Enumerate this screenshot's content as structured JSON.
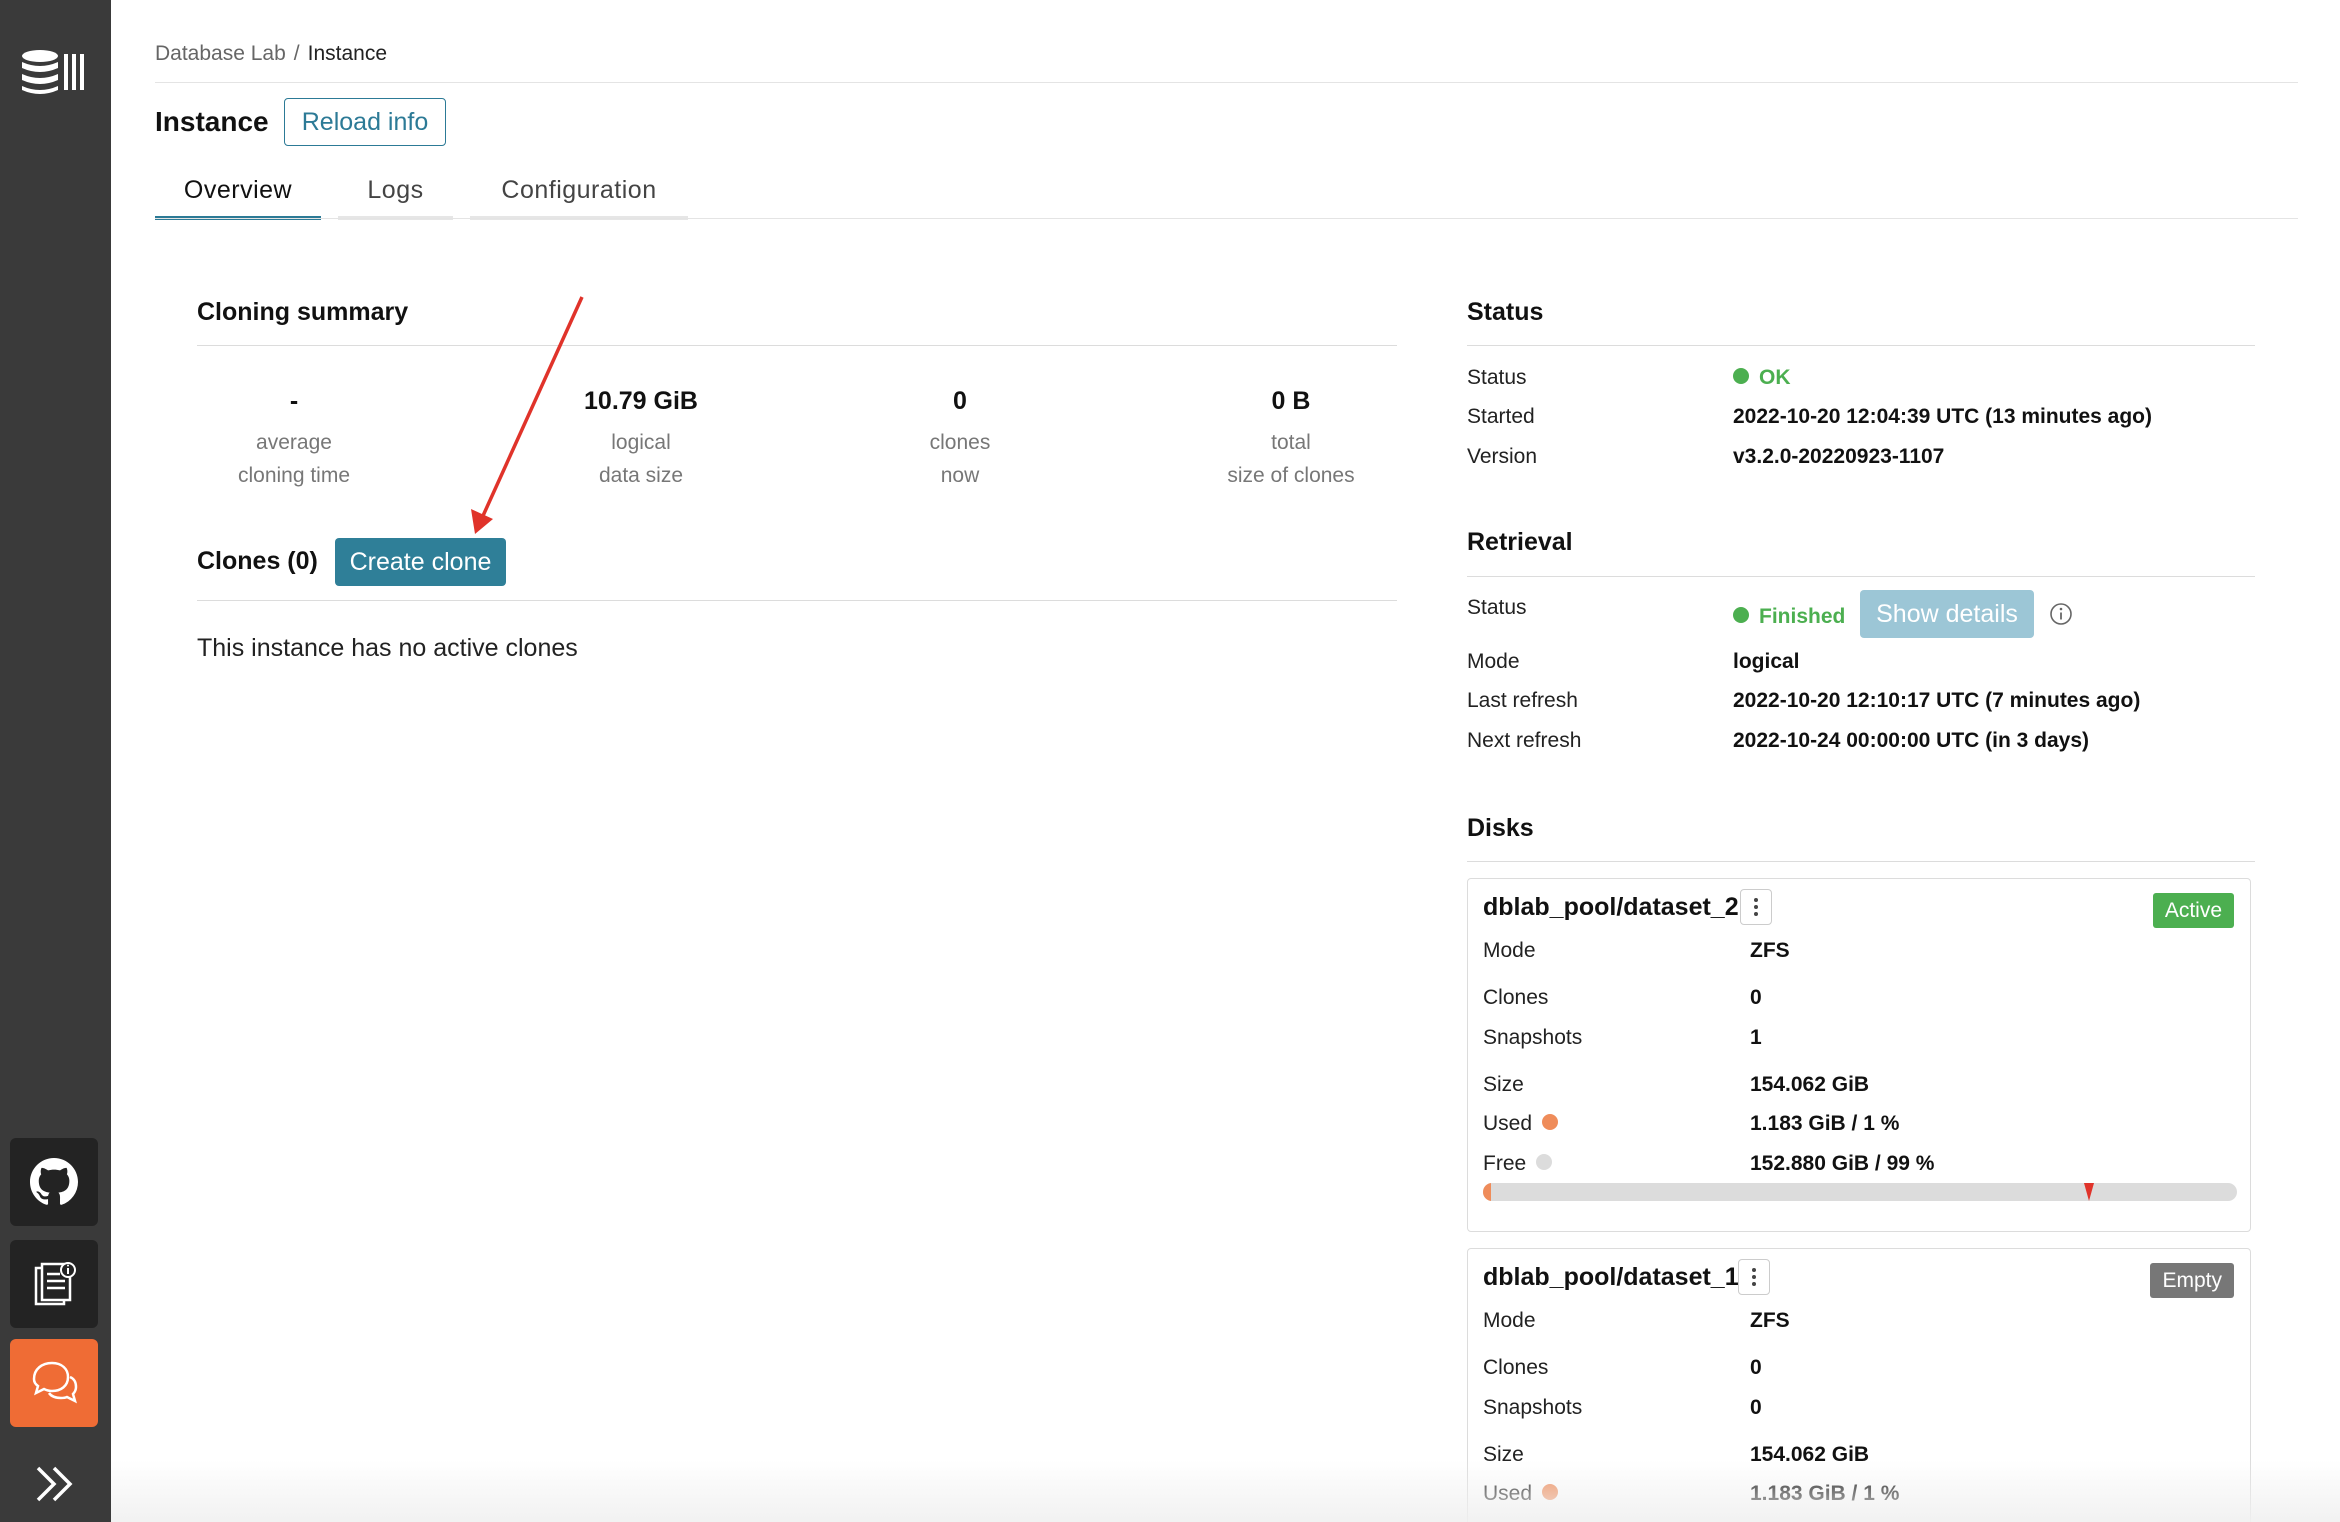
{
  "sidebar": {
    "logo_icon": "database-logo-icon",
    "items": [
      {
        "icon": "github-icon",
        "label": "GitHub"
      },
      {
        "icon": "docs-icon",
        "label": "Documentation"
      },
      {
        "icon": "chat-icon",
        "label": "Support chat",
        "color": "#ef6c35"
      },
      {
        "icon": "expand-icon",
        "label": "Expand sidebar"
      }
    ]
  },
  "breadcrumb": {
    "parent": "Database Lab",
    "separator": "/",
    "current": "Instance"
  },
  "header": {
    "title": "Instance",
    "reload_label": "Reload info"
  },
  "tabs": [
    {
      "label": "Overview",
      "active": true
    },
    {
      "label": "Logs",
      "active": false
    },
    {
      "label": "Configuration",
      "active": false
    }
  ],
  "cloning_summary": {
    "title": "Cloning summary",
    "stats": [
      {
        "value": "-",
        "label_1": "average",
        "label_2": "cloning time"
      },
      {
        "value": "10.79 GiB",
        "label_1": "logical",
        "label_2": "data size"
      },
      {
        "value": "0",
        "label_1": "clones",
        "label_2": "now"
      },
      {
        "value": "0 B",
        "label_1": "total",
        "label_2": "size of clones"
      }
    ]
  },
  "clones": {
    "title": "Clones (0)",
    "create_label": "Create clone",
    "empty_text": "This instance has no active clones"
  },
  "status": {
    "title": "Status",
    "rows": [
      {
        "label": "Status",
        "value": "OK"
      },
      {
        "label": "Started",
        "value": "2022-10-20 12:04:39 UTC (13 minutes ago)"
      },
      {
        "label": "Version",
        "value": "v3.2.0-20220923-1107"
      }
    ]
  },
  "retrieval": {
    "title": "Retrieval",
    "status_label": "Status",
    "status_value": "Finished",
    "show_details_label": "Show details",
    "rows": [
      {
        "label": "Mode",
        "value": "logical"
      },
      {
        "label": "Last refresh",
        "value": "2022-10-20 12:10:17 UTC (7 minutes ago)"
      },
      {
        "label": "Next refresh",
        "value": "2022-10-24 00:00:00 UTC (in 3 days)"
      }
    ]
  },
  "disks": {
    "title": "Disks",
    "items": [
      {
        "name": "dblab_pool/dataset_2",
        "badge": "Active",
        "mode_label": "Mode",
        "mode": "ZFS",
        "clones_label": "Clones",
        "clones": "0",
        "snapshots_label": "Snapshots",
        "snapshots": "1",
        "size_label": "Size",
        "size": "154.062 GiB",
        "used_label": "Used",
        "used": "1.183 GiB / 1 %",
        "free_label": "Free",
        "free": "152.880 GiB / 99 %",
        "used_fraction": 0.01
      },
      {
        "name": "dblab_pool/dataset_1",
        "badge": "Empty",
        "mode_label": "Mode",
        "mode": "ZFS",
        "clones_label": "Clones",
        "clones": "0",
        "snapshots_label": "Snapshots",
        "snapshots": "0",
        "size_label": "Size",
        "size": "154.062 GiB",
        "used_label": "Used",
        "used": "1.183 GiB / 1 %"
      }
    ]
  },
  "colors": {
    "accent": "#2c7a96",
    "ok_green": "#4caf50",
    "used_orange": "#ef8c5a",
    "free_gray": "#dcdcdc",
    "sidebar_bg": "#3a3a3a",
    "annotation_arrow": "#e0332a"
  }
}
